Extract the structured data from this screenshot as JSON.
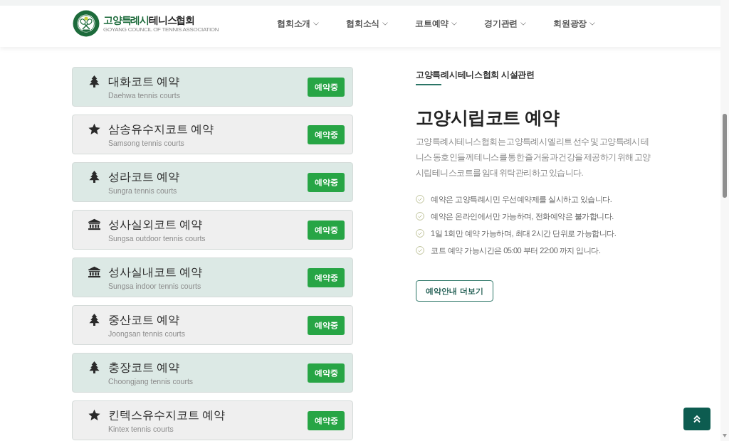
{
  "header": {
    "logo": {
      "title_parts": [
        "고양특례시",
        "테니스협회"
      ],
      "subtitle": "GOYANG COUNCIL OF TENNIS ASSOCIATION"
    },
    "nav": [
      "협회소개",
      "협회소식",
      "코트예약",
      "경기관련",
      "회원광장"
    ]
  },
  "courts": [
    {
      "kind": "tree",
      "title": "대화코트 예약",
      "subtitle": "Daehwa tennis courts",
      "button": "예약중"
    },
    {
      "kind": "star",
      "title": "삼송유수지코트 예약",
      "subtitle": "Samsong tennis courts",
      "button": "예약중"
    },
    {
      "kind": "tree",
      "title": "성라코트 예약",
      "subtitle": "Sungra tennis courts",
      "button": "예약중"
    },
    {
      "kind": "building",
      "title": "성사실외코트 예약",
      "subtitle": "Sungsa outdoor tennis courts",
      "button": "예약중"
    },
    {
      "kind": "building",
      "title": "성사실내코트 예약",
      "subtitle": "Sungsa indoor tennis courts",
      "button": "예약중"
    },
    {
      "kind": "tree",
      "title": "중산코트 예약",
      "subtitle": "Joongsan tennis courts",
      "button": "예약중"
    },
    {
      "kind": "tree",
      "title": "충장코트 예약",
      "subtitle": "Choongjang tennis courts",
      "button": "예약중"
    },
    {
      "kind": "star",
      "title": "킨텍스유수지코트 예약",
      "subtitle": "Kintex tennis courts",
      "button": "예약중"
    }
  ],
  "info": {
    "eyebrow": "고양특례시테니스협회 시설관련",
    "title": "고양시립코트 예약",
    "description": "고양특례시테니스협회는 고양특례시 엘리트 선수 및 고양특례시 테니스 동호인들께 테니스를 통한 즐거움과 건강을 제공하기 위해 고양시립테니스코트를 임대 위탁관리하고 있습니다.",
    "notes": [
      "예약은 고양특례시민 우선예약제를 실시하고 있습니다.",
      "예약은 온라인에서만 가능하며, 전화예약은 불가합니다.",
      "1일 1회만 예약 가능하며, 최대 2시간 단위로 가능합니다.",
      "코트 예약 가능시간은 05:00 부터 22:00 까지 입니다."
    ],
    "button": "예약안내 더보기"
  }
}
